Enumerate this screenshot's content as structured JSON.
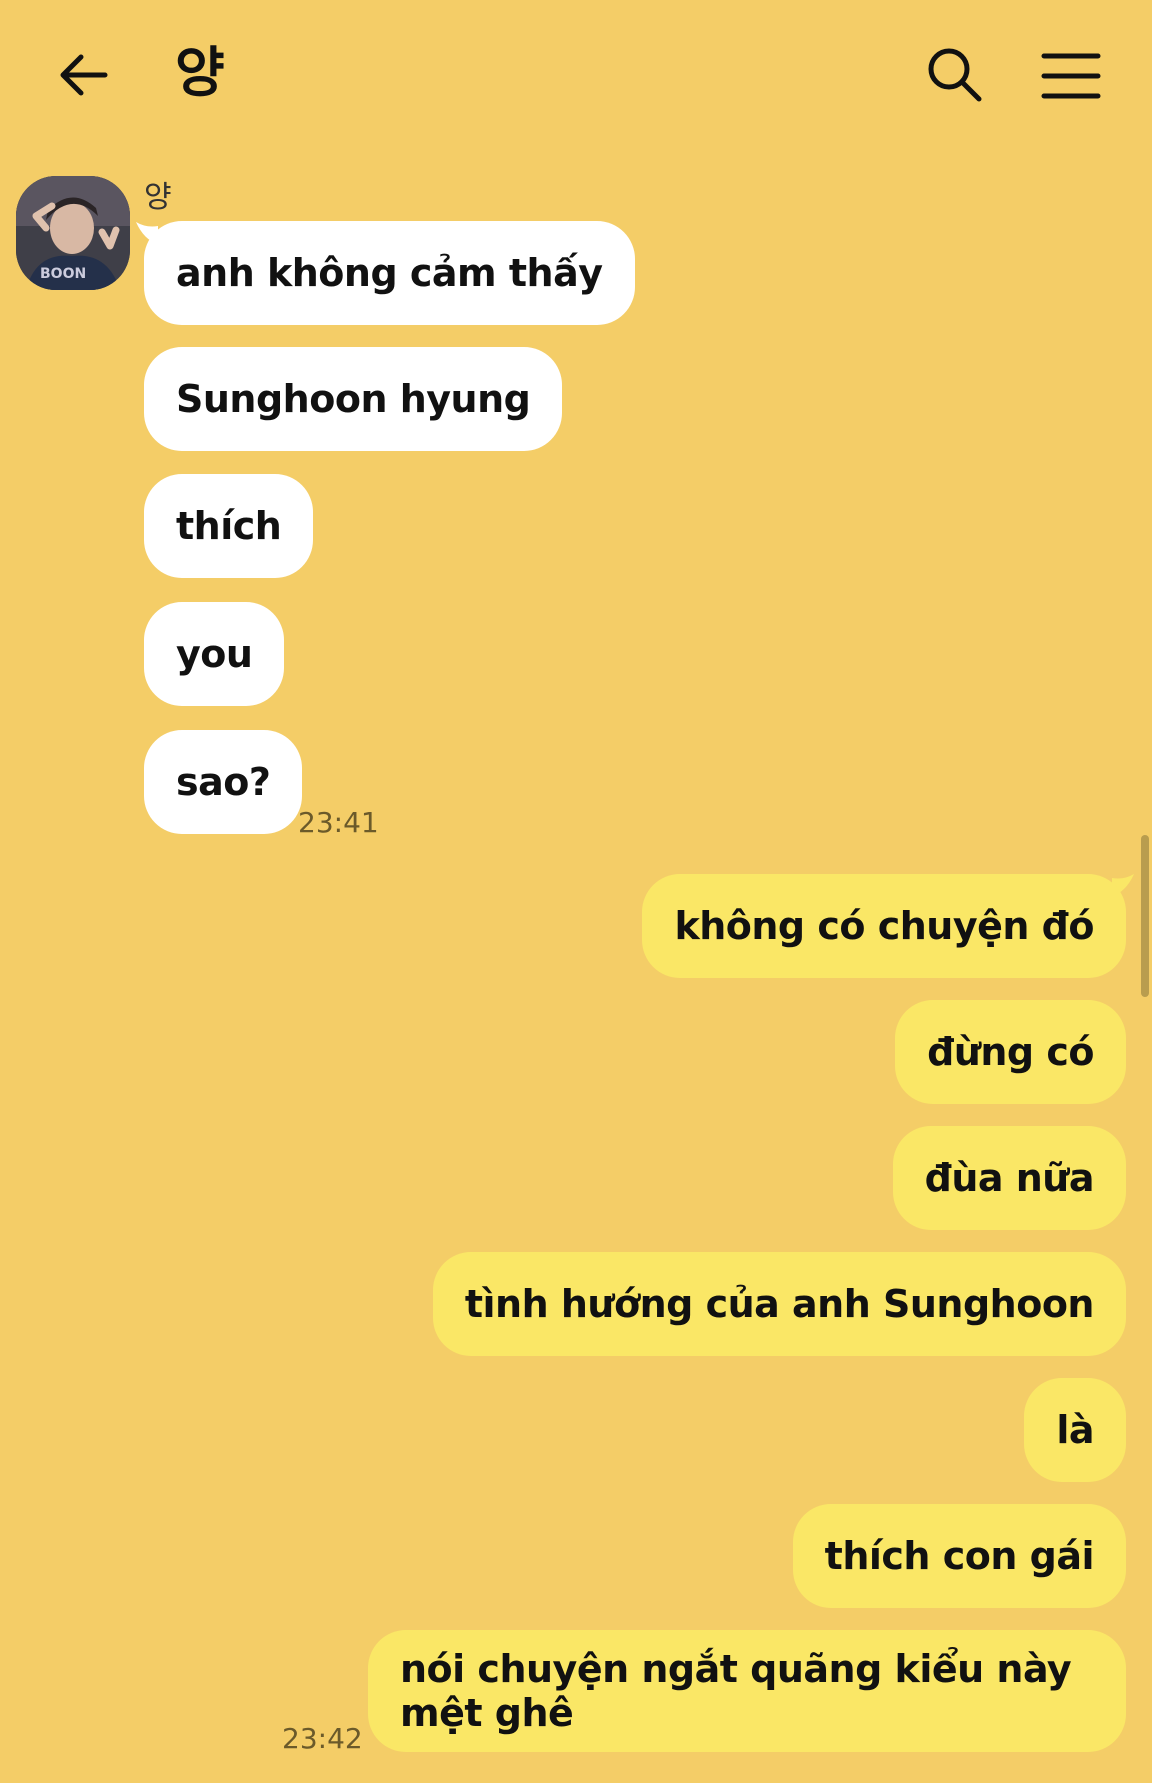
{
  "header": {
    "title": "양",
    "back_icon": "arrow-left-icon",
    "search_icon": "search-icon",
    "menu_icon": "hamburger-menu-icon"
  },
  "colors": {
    "background": "#f4cd67",
    "incoming_bubble": "#ffffff",
    "outgoing_bubble": "#fae766"
  },
  "incoming": {
    "sender_name": "양",
    "messages": [
      "anh không cảm thấy",
      "Sunghoon hyung",
      "thích",
      "you",
      "sao?"
    ],
    "time": "23:41"
  },
  "outgoing": {
    "messages": [
      "không có chuyện đó",
      "đừng có",
      "đùa nữa",
      "tình hướng của anh Sunghoon",
      "là",
      "thích con gái",
      "nói chuyện ngắt quãng kiểu này mệt ghê"
    ],
    "time": "23:42"
  }
}
